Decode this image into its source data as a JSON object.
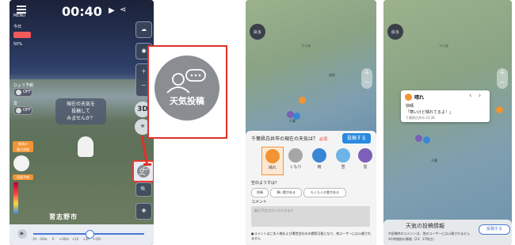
{
  "phone1": {
    "time": "00:40",
    "menu_label": "MENU",
    "today_label": "今日",
    "precip_chance": "50%",
    "toggle1_label": "ひょう予報",
    "toggle2_label": "雷",
    "toggle_state": "OFF",
    "bubble_text": [
      "現在の天気を",
      "投稿して",
      "みませんか？"
    ],
    "btn_3d": "3D",
    "left_badge": [
      "観測の",
      "最大雨量"
    ],
    "left_badge2": "雨量予報",
    "city_label": "習志野市",
    "btn_search": "現在地",
    "btn_loc": "現在地",
    "timeline_ticks": [
      "-1h",
      "-30m",
      "0",
      "+30m",
      "+1h",
      "+3h",
      "+15h"
    ]
  },
  "callout": {
    "label": "天気投稿"
  },
  "phone2": {
    "back_label": "戻る",
    "question": "千葉県白井市の現在の天気は？",
    "required": "必須",
    "post_button": "投稿する",
    "weather_options": [
      {
        "label": "晴れ",
        "color": "#f29433"
      },
      {
        "label": "くもり",
        "color": "#a6a6a6"
      },
      {
        "label": "雨",
        "color": "#3a86d6"
      },
      {
        "label": "雪",
        "color": "#6cb3e6"
      },
      {
        "label": "雷",
        "color": "#7b5fb8"
      }
    ],
    "sky_question": "空のようすは？",
    "chips": [
      "快晴",
      "薄い雲がある",
      "もくもくの雲がある"
    ],
    "comment_label": "コメント",
    "comment_placeholder": "最大70文字が入力できます",
    "note": "●コメントはご本人様および運営会社のみ閲覧可能となり、他ユーザーには公開されません"
  },
  "phone3": {
    "back_label": "戻る",
    "tooltip_weather": "晴れ",
    "tooltip_sky": "快晴",
    "tooltip_comment": "「寒いけど晴れてるよ！」",
    "tooltip_meta": "千葉県白井市 23:36",
    "footer_title": "天気の投稿情報",
    "post_button": "投稿する",
    "note1": "※投稿時のコメントは、他のユーザーには公開されません",
    "note2": "※1時間前の情報（23：37時点）"
  },
  "colors": {
    "callout_red": "#e0322b",
    "accent_blue": "#2a8ae0",
    "sunny_orange": "#f29433"
  }
}
